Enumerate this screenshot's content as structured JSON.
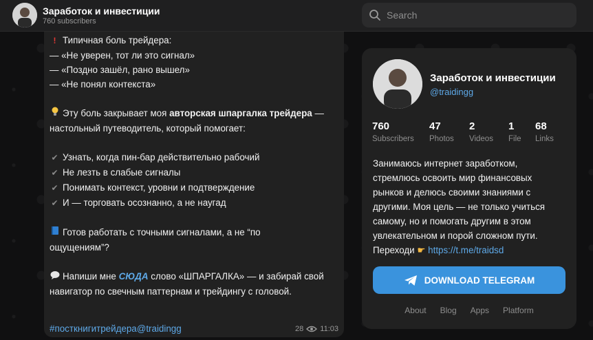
{
  "header": {
    "channel_name": "Заработок и инвестиции",
    "subscribers": "760 subscribers"
  },
  "search": {
    "placeholder": "Search"
  },
  "post": {
    "lines": [
      "Типичная боль трейдера:",
      "— «Не уверен, тот ли это сигнал»",
      "— «Поздно зашёл, рано вышел»",
      "— «Не понял контекста»"
    ],
    "pain_intro": "Эту боль закрывает моя ",
    "pain_bold": "авторская шпаргалка трейдера",
    "pain_tail": " —",
    "pain_line2": "настольный путеводитель, который помогает:",
    "checks": [
      "Узнать, когда пин-бар действительно рабочий",
      "Не лезть в слабые сигналы",
      "Понимать контекст, уровни и подтверждение",
      "И — торговать осознанно, а не наугад"
    ],
    "ready_line1": "Готов работать с точными сигналами, а не “по",
    "ready_line2": "ощущениям”?",
    "cta_pre": "Напиши мне ",
    "cta_link": "СЮДА",
    "cta_post": " слово «ШПАРГАЛКА» — и забирай свой",
    "cta_line2": "навигатор по свечным паттернам и трейдингу с головой.",
    "hashtag": "#посткнигитрейдера@traidingg",
    "views": "28",
    "time": "11:03"
  },
  "card": {
    "name": "Заработок и инвестиции",
    "handle": "@traidingg",
    "stats": [
      {
        "num": "760",
        "label": "Subscribers"
      },
      {
        "num": "47",
        "label": "Photos"
      },
      {
        "num": "2",
        "label": "Videos"
      },
      {
        "num": "1",
        "label": "File"
      },
      {
        "num": "68",
        "label": "Links"
      }
    ],
    "desc_lines": [
      "Занимаюсь интернет заработком,",
      "стремлюсь освоить мир финансовых",
      "рынков и делюсь своими знаниями с",
      "другими. Моя цель — не только учиться",
      "самому, но и помогать другим в этом",
      "увлекательном и порой сложном пути."
    ],
    "desc_last_pre": "Переходи",
    "desc_link": "https://t.me/traidsd",
    "download_label": "DOWNLOAD TELEGRAM",
    "footer": [
      "About",
      "Blog",
      "Apps",
      "Platform"
    ]
  },
  "colors": {
    "accent": "#3a93dd",
    "link": "#5ea9e8",
    "bg": "#212121"
  },
  "icons": [
    "search-icon",
    "telegram-icon",
    "eye-icon",
    "exclamation-icon",
    "bulb-icon",
    "check-icon",
    "book-icon",
    "speech-icon",
    "pointing-hand-icon"
  ]
}
